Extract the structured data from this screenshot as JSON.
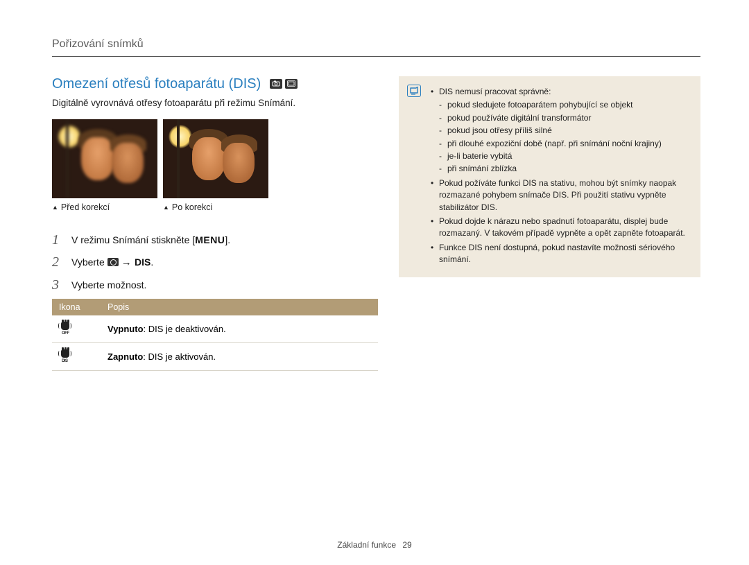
{
  "header": {
    "breadcrumb": "Pořizování snímků"
  },
  "section": {
    "title": "Omezení otřesů fotoaparátu (DIS)",
    "mode_icons": [
      "camera-p-icon",
      "scene-icon"
    ],
    "intro": "Digitálně vyrovnává otřesy fotoaparátu při režimu Snímání."
  },
  "photos": {
    "before_caption": "Před korekcí",
    "after_caption": "Po korekci"
  },
  "steps": [
    {
      "num": "1",
      "pre": "V režimu Snímání stiskněte [",
      "key": "MENU",
      "post": "]."
    },
    {
      "num": "2",
      "pre": "Vyberte ",
      "icon": "camera-icon",
      "arrow": " → ",
      "bold": "DIS",
      "post2": "."
    },
    {
      "num": "3",
      "text": "Vyberte možnost."
    }
  ],
  "table": {
    "head_icon": "Ikona",
    "head_desc": "Popis",
    "rows": [
      {
        "icon": "dis-off-icon",
        "bold": "Vypnuto",
        "rest": ": DIS je deaktivován."
      },
      {
        "icon": "dis-on-icon",
        "bold": "Zapnuto",
        "rest": ": DIS je aktivován."
      }
    ]
  },
  "note": {
    "lead": "DIS nemusí pracovat správně:",
    "sub": [
      "pokud sledujete fotoaparátem pohybující se objekt",
      "pokud používáte digitální transformátor",
      "pokud jsou otřesy příliš silné",
      "při dlouhé expoziční době (např. při snímání noční krajiny)",
      "je-li baterie vybitá",
      "při snímání zblízka"
    ],
    "bullets": [
      "Pokud požíváte funkci DIS na stativu, mohou být snímky naopak rozmazané pohybem snímače DIS. Při použití stativu vypněte stabilizátor DIS.",
      "Pokud dojde k nárazu nebo spadnutí fotoaparátu, displej bude rozmazaný. V takovém případě vypněte a opět zapněte fotoaparát.",
      "Funkce DIS není dostupná, pokud nastavíte možnosti sériového snímání."
    ]
  },
  "footer": {
    "label": "Základní funkce",
    "page": "29"
  }
}
